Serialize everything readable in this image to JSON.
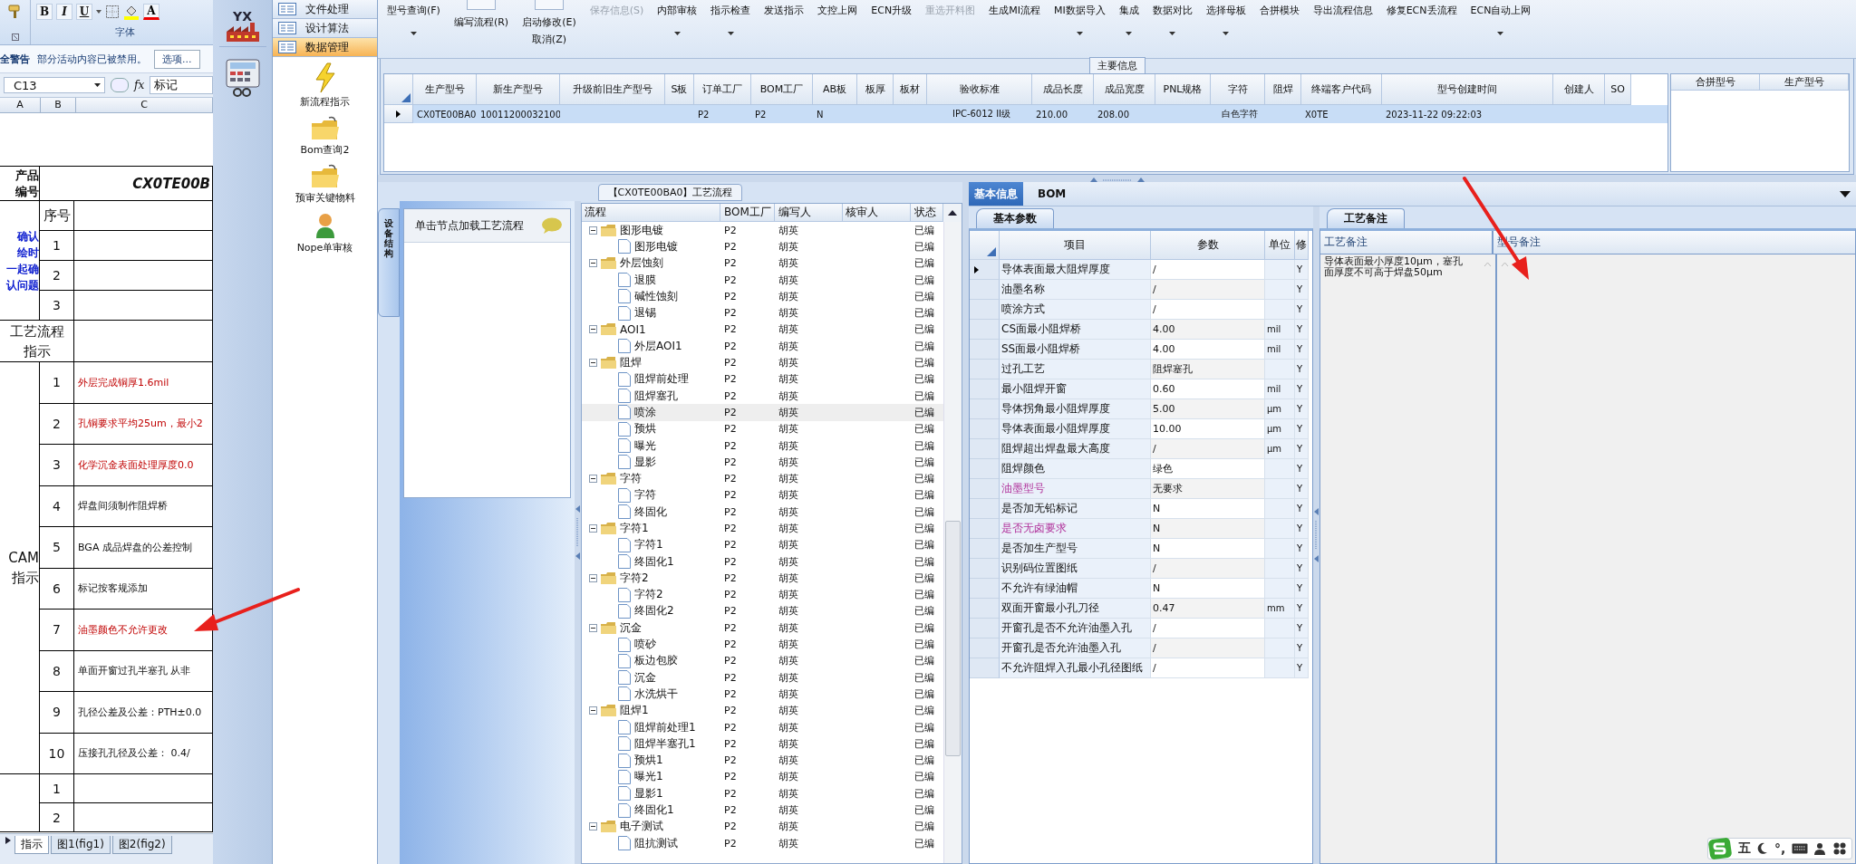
{
  "excel": {
    "format_buttons": [
      "B",
      "I",
      "U"
    ],
    "font_color_label": "A",
    "group_label": "字体",
    "security_bar": {
      "title": "全警告",
      "message": "部分活动内容已被禁用。",
      "button": "选项..."
    },
    "formula_bar": {
      "cell": "C13",
      "fx": "fx",
      "content": "标记"
    },
    "columns": [
      "A",
      "B",
      "C"
    ],
    "product": {
      "label_lines": [
        "产品",
        "编号"
      ],
      "value": "CX0TE00B"
    },
    "confirm": {
      "label_lines": [
        "确认",
        "绘时",
        "一起确",
        "认问题"
      ],
      "seq_header": "序号",
      "rows": [
        "1",
        "2",
        "3"
      ]
    },
    "flow_label_lines": [
      "工艺流程",
      "指示"
    ],
    "cam": {
      "label_lines": [
        "CAM",
        "指示"
      ],
      "rows": [
        {
          "no": "1",
          "text": "外层完成铜厚1.6mil",
          "alert": true
        },
        {
          "no": "2",
          "text": "孔铜要求平均25um，最小2",
          "alert": true
        },
        {
          "no": "3",
          "text": "化学沉金表面处理厚度0.0",
          "alert": true
        },
        {
          "no": "4",
          "text": "焊盘间须制作阻焊桥",
          "alert": false
        },
        {
          "no": "5",
          "text": "BGA 成品焊盘的公差控制",
          "alert": false
        },
        {
          "no": "6",
          "text": "标记按客规添加",
          "alert": false
        },
        {
          "no": "7",
          "text": "油墨颜色不允许更改",
          "alert": true
        },
        {
          "no": "8",
          "text": "单面开窗过孔半塞孔 从非",
          "alert": false
        },
        {
          "no": "9",
          "text": "孔径公差及公差：PTH±0.0",
          "alert": false
        },
        {
          "no": "10",
          "text": "压接孔孔径及公差： 0.4/",
          "alert": false
        }
      ]
    },
    "extra_rows": [
      "1",
      "2"
    ],
    "sheets": [
      {
        "label": "指示",
        "selected": true
      },
      {
        "label": "图1(fig1)",
        "selected": false
      },
      {
        "label": "图2(fig2)",
        "selected": false
      }
    ]
  },
  "app": {
    "logo_text": "YX",
    "nav": {
      "groups": [
        {
          "label": "文件处理",
          "selected": false
        },
        {
          "label": "设计算法",
          "selected": false
        },
        {
          "label": "数据管理",
          "selected": true
        }
      ],
      "tools": [
        {
          "label": "新流程指示",
          "kind": "bolt"
        },
        {
          "label": "Bom查询2",
          "kind": "folder"
        },
        {
          "label": "预审关键物料",
          "kind": "folder"
        },
        {
          "label": "Nope单审核",
          "kind": "user"
        }
      ]
    },
    "toolbar": [
      {
        "label": "型号查询(F)",
        "kind": "menu",
        "disabled": false
      },
      {
        "label": "编写流程(R)",
        "kind": "boxed",
        "disabled": false
      },
      {
        "label": "启动修改(E)",
        "sublabel": "取消(Z)",
        "kind": "boxed",
        "disabled": false
      },
      {
        "label": "保存信息(S)",
        "kind": "plain",
        "disabled": true
      },
      {
        "label": "内部审核",
        "kind": "menu",
        "disabled": false
      },
      {
        "label": "指示检查",
        "kind": "menu",
        "disabled": false
      },
      {
        "label": "发送指示",
        "kind": "plain",
        "disabled": false
      },
      {
        "label": "文控上网",
        "kind": "plain",
        "disabled": false
      },
      {
        "label": "ECN升级",
        "kind": "plain",
        "disabled": false
      },
      {
        "label": "重选开料图",
        "kind": "plain",
        "disabled": true
      },
      {
        "label": "生成MI流程",
        "kind": "plain",
        "disabled": false
      },
      {
        "label": "MI数据导入",
        "kind": "menu",
        "disabled": false
      },
      {
        "label": "集成",
        "kind": "menu",
        "disabled": false
      },
      {
        "label": "数据对比",
        "kind": "menu",
        "disabled": false
      },
      {
        "label": "选择母板",
        "kind": "menu",
        "disabled": false
      },
      {
        "label": "合拼模块",
        "kind": "plain",
        "disabled": false
      },
      {
        "label": "导出流程信息",
        "kind": "plain",
        "disabled": false
      },
      {
        "label": "修复ECN丢流程",
        "kind": "plain",
        "disabled": false
      },
      {
        "label": "ECN自动上网",
        "kind": "menu",
        "disabled": false
      }
    ],
    "main_info": {
      "title": "主要信息",
      "columns": [
        "生产型号",
        "新生产型号",
        "升级前旧生产型号",
        "S板",
        "订单工厂",
        "BOM工厂",
        "AB板",
        "板厚",
        "板材",
        "验收标准",
        "成品长度",
        "成品宽度",
        "PNL规格",
        "字符",
        "阻焊",
        "终端客户代码",
        "型号创建时间",
        "创建人",
        "SO"
      ],
      "rows": [
        {
          "selected": true,
          "current": true,
          "cells": [
            "CX0TE00BA0",
            "10011200032100",
            null,
            null,
            "P2",
            "P2",
            "N",
            null,
            null,
            "IPC-6012 II级",
            "210.00",
            "208.00",
            null,
            "白色字符",
            null,
            "X0TE",
            "2023-11-22 09:22:03",
            null,
            null
          ]
        }
      ],
      "side_columns": [
        "合拼型号",
        "生产型号"
      ]
    },
    "process": {
      "title": "【CX0TE00BA0】工艺流程",
      "side_tab": "设备结构",
      "hint": "单击节点加载工艺流程",
      "columns": [
        "流程",
        "BOM工厂",
        "编写人",
        "核审人",
        "状态"
      ],
      "tree": [
        {
          "name": "图形电镀",
          "bom": "P2",
          "writer": "胡英",
          "status": "已编",
          "expanded": true,
          "selected": false,
          "children": [
            {
              "name": "图形电镀",
              "bom": "P2",
              "writer": "胡英",
              "status": "已编",
              "selected": false
            }
          ]
        },
        {
          "name": "外层蚀刻",
          "bom": "P2",
          "writer": "胡英",
          "status": "已编",
          "expanded": true,
          "selected": false,
          "children": [
            {
              "name": "退膜",
              "bom": "P2",
              "writer": "胡英",
              "status": "已编",
              "selected": false
            },
            {
              "name": "碱性蚀刻",
              "bom": "P2",
              "writer": "胡英",
              "status": "已编",
              "selected": false
            },
            {
              "name": "退锡",
              "bom": "P2",
              "writer": "胡英",
              "status": "已编",
              "selected": false
            }
          ]
        },
        {
          "name": "AOI1",
          "bom": "P2",
          "writer": "胡英",
          "status": "已编",
          "expanded": true,
          "selected": false,
          "children": [
            {
              "name": "外层AOI1",
              "bom": "P2",
              "writer": "胡英",
              "status": "已编",
              "selected": false
            }
          ]
        },
        {
          "name": "阻焊",
          "bom": "P2",
          "writer": "胡英",
          "status": "已编",
          "expanded": true,
          "selected": false,
          "children": [
            {
              "name": "阻焊前处理",
              "bom": "P2",
              "writer": "胡英",
              "status": "已编",
              "selected": false
            },
            {
              "name": "阻焊塞孔",
              "bom": "P2",
              "writer": "胡英",
              "status": "已编",
              "selected": false
            },
            {
              "name": "喷涂",
              "bom": "P2",
              "writer": "胡英",
              "status": "已编",
              "selected": true
            },
            {
              "name": "预烘",
              "bom": "P2",
              "writer": "胡英",
              "status": "已编",
              "selected": false
            },
            {
              "name": "曝光",
              "bom": "P2",
              "writer": "胡英",
              "status": "已编",
              "selected": false
            },
            {
              "name": "显影",
              "bom": "P2",
              "writer": "胡英",
              "status": "已编",
              "selected": false
            }
          ]
        },
        {
          "name": "字符",
          "bom": "P2",
          "writer": "胡英",
          "status": "已编",
          "expanded": true,
          "selected": false,
          "children": [
            {
              "name": "字符",
              "bom": "P2",
              "writer": "胡英",
              "status": "已编",
              "selected": false
            },
            {
              "name": "终固化",
              "bom": "P2",
              "writer": "胡英",
              "status": "已编",
              "selected": false
            }
          ]
        },
        {
          "name": "字符1",
          "bom": "P2",
          "writer": "胡英",
          "status": "已编",
          "expanded": true,
          "selected": false,
          "children": [
            {
              "name": "字符1",
              "bom": "P2",
              "writer": "胡英",
              "status": "已编",
              "selected": false
            },
            {
              "name": "终固化1",
              "bom": "P2",
              "writer": "胡英",
              "status": "已编",
              "selected": false
            }
          ]
        },
        {
          "name": "字符2",
          "bom": "P2",
          "writer": "胡英",
          "status": "已编",
          "expanded": true,
          "selected": false,
          "children": [
            {
              "name": "字符2",
              "bom": "P2",
              "writer": "胡英",
              "status": "已编",
              "selected": false
            },
            {
              "name": "终固化2",
              "bom": "P2",
              "writer": "胡英",
              "status": "已编",
              "selected": false
            }
          ]
        },
        {
          "name": "沉金",
          "bom": "P2",
          "writer": "胡英",
          "status": "已编",
          "expanded": true,
          "selected": false,
          "children": [
            {
              "name": "喷砂",
              "bom": "P2",
              "writer": "胡英",
              "status": "已编",
              "selected": false
            },
            {
              "name": "板边包胶",
              "bom": "P2",
              "writer": "胡英",
              "status": "已编",
              "selected": false
            },
            {
              "name": "沉金",
              "bom": "P2",
              "writer": "胡英",
              "status": "已编",
              "selected": false
            },
            {
              "name": "水洗烘干",
              "bom": "P2",
              "writer": "胡英",
              "status": "已编",
              "selected": false
            }
          ]
        },
        {
          "name": "阻焊1",
          "bom": "P2",
          "writer": "胡英",
          "status": "已编",
          "expanded": true,
          "selected": false,
          "children": [
            {
              "name": "阻焊前处理1",
              "bom": "P2",
              "writer": "胡英",
              "status": "已编",
              "selected": false
            },
            {
              "name": "阻焊半塞孔1",
              "bom": "P2",
              "writer": "胡英",
              "status": "已编",
              "selected": false
            },
            {
              "name": "预烘1",
              "bom": "P2",
              "writer": "胡英",
              "status": "已编",
              "selected": false
            },
            {
              "name": "曝光1",
              "bom": "P2",
              "writer": "胡英",
              "status": "已编",
              "selected": false
            },
            {
              "name": "显影1",
              "bom": "P2",
              "writer": "胡英",
              "status": "已编",
              "selected": false
            },
            {
              "name": "终固化1",
              "bom": "P2",
              "writer": "胡英",
              "status": "已编",
              "selected": false
            }
          ]
        },
        {
          "name": "电子测试",
          "bom": "P2",
          "writer": "胡英",
          "status": "已编",
          "expanded": true,
          "selected": false,
          "children": [
            {
              "name": "阻抗测试",
              "bom": "P2",
              "writer": "胡英",
              "status": "已编",
              "selected": false
            }
          ]
        }
      ]
    },
    "params": {
      "tabs": [
        {
          "label": "基本信息",
          "selected": true
        },
        {
          "label": "BOM",
          "selected": false
        }
      ],
      "subtab": "基本参数",
      "columns": [
        "项目",
        "参数",
        "单位",
        "修"
      ],
      "rows": [
        {
          "item": "导体表面最大阻焊厚度",
          "value": "/",
          "flag": "Y",
          "highlight": false,
          "current": true
        },
        {
          "item": "油墨名称",
          "value": "/",
          "flag": "Y",
          "highlight": false,
          "current": false
        },
        {
          "item": "喷涂方式",
          "value": "/",
          "flag": "Y",
          "highlight": false,
          "current": false
        },
        {
          "item": "CS面最小阻焊桥",
          "value": "4.00",
          "unit": "mil",
          "flag": "Y",
          "highlight": false,
          "current": false
        },
        {
          "item": "SS面最小阻焊桥",
          "value": "4.00",
          "unit": "mil",
          "flag": "Y",
          "highlight": false,
          "current": false
        },
        {
          "item": "过孔工艺",
          "value": "阻焊塞孔",
          "flag": "Y",
          "highlight": false,
          "current": false
        },
        {
          "item": "最小阻焊开窗",
          "value": "0.60",
          "unit": "mil",
          "flag": "Y",
          "highlight": false,
          "current": false
        },
        {
          "item": "导体拐角最小阻焊厚度",
          "value": "5.00",
          "unit": "μm",
          "flag": "Y",
          "highlight": false,
          "current": false
        },
        {
          "item": "导体表面最小阻焊厚度",
          "value": "10.00",
          "unit": "μm",
          "flag": "Y",
          "highlight": false,
          "current": false
        },
        {
          "item": "阻焊超出焊盘最大高度",
          "value": "/",
          "unit": "μm",
          "flag": "Y",
          "highlight": false,
          "current": false
        },
        {
          "item": "阻焊颜色",
          "value": "绿色",
          "flag": "Y",
          "highlight": false,
          "current": false
        },
        {
          "item": "油墨型号",
          "value": "无要求",
          "flag": "Y",
          "highlight": true,
          "current": false
        },
        {
          "item": "是否加无铅标记",
          "value": "N",
          "flag": "Y",
          "highlight": false,
          "current": false
        },
        {
          "item": "是否无卤要求",
          "value": "N",
          "flag": "Y",
          "highlight": true,
          "current": false
        },
        {
          "item": "是否加生产型号",
          "value": "N",
          "flag": "Y",
          "highlight": false,
          "current": false
        },
        {
          "item": "识别码位置图纸",
          "value": "/",
          "flag": "Y",
          "highlight": false,
          "current": false
        },
        {
          "item": "不允许有绿油帽",
          "value": "N",
          "flag": "Y",
          "highlight": false,
          "current": false
        },
        {
          "item": "双面开窗最小孔刀径",
          "value": "0.47",
          "unit": "mm",
          "flag": "Y",
          "highlight": false,
          "current": false
        },
        {
          "item": "开窗孔是否不允许油墨入孔",
          "value": "/",
          "flag": "Y",
          "highlight": false,
          "current": false
        },
        {
          "item": "开窗孔是否允许油墨入孔",
          "value": "/",
          "flag": "Y",
          "highlight": false,
          "current": false
        },
        {
          "item": "不允许阻焊入孔最小孔径图纸",
          "value": "/",
          "flag": "Y",
          "highlight": false,
          "current": false
        }
      ]
    },
    "remarks": {
      "subtab": "工艺备注",
      "columns": [
        "工艺备注",
        "型号备注"
      ],
      "process_note": "导体表面最小厚度10μm，塞孔面厚度不可高于焊盘50μm"
    }
  },
  "ime": {
    "mode": "五",
    "punct": "°,"
  }
}
